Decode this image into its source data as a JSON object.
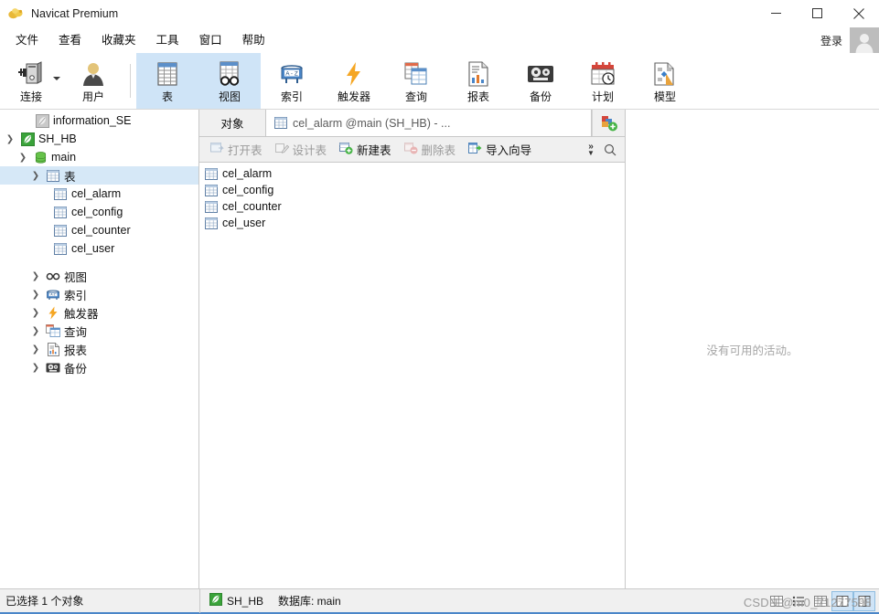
{
  "window": {
    "title": "Navicat Premium",
    "logo_icon": "navicat-logo-icon",
    "minimize_label": "—",
    "maximize_label": "☐",
    "close_label": "✕"
  },
  "menubar": {
    "items": [
      {
        "label": "文件",
        "name": "menu-file"
      },
      {
        "label": "查看",
        "name": "menu-view"
      },
      {
        "label": "收藏夹",
        "name": "menu-favorites"
      },
      {
        "label": "工具",
        "name": "menu-tools"
      },
      {
        "label": "窗口",
        "name": "menu-window"
      },
      {
        "label": "帮助",
        "name": "menu-help"
      }
    ],
    "login_label": "登录",
    "avatar_icon": "user-avatar-icon"
  },
  "toolbar": {
    "items": [
      {
        "label": "连接",
        "icon": "connection-icon",
        "selected": false,
        "has_caret": true
      },
      {
        "label": "用户",
        "icon": "user-icon",
        "selected": false,
        "has_caret": false
      },
      {
        "label": "表",
        "icon": "table-icon",
        "selected": true,
        "has_caret": false
      },
      {
        "label": "视图",
        "icon": "view-glasses-icon",
        "selected": true,
        "has_caret": false
      },
      {
        "label": "索引",
        "icon": "index-az-icon",
        "selected": false,
        "has_caret": false
      },
      {
        "label": "触发器",
        "icon": "trigger-bolt-icon",
        "selected": false,
        "has_caret": false
      },
      {
        "label": "查询",
        "icon": "query-icon",
        "selected": false,
        "has_caret": false
      },
      {
        "label": "报表",
        "icon": "report-icon",
        "selected": false,
        "has_caret": false
      },
      {
        "label": "备份",
        "icon": "backup-tape-icon",
        "selected": false,
        "has_caret": false
      },
      {
        "label": "计划",
        "icon": "schedule-calendar-icon",
        "selected": false,
        "has_caret": false
      },
      {
        "label": "模型",
        "icon": "model-icon",
        "selected": false,
        "has_caret": false
      }
    ]
  },
  "sidebar": {
    "nodes": [
      {
        "label": "information_SE",
        "icon": "connection-leaf-gray-icon",
        "indent": 1,
        "chevron": "none",
        "selected": false
      },
      {
        "label": "SH_HB",
        "icon": "connection-leaf-green-icon",
        "indent": 0,
        "chevron": "down",
        "selected": false
      },
      {
        "label": "main",
        "icon": "database-icon",
        "indent": 1,
        "chevron": "down",
        "selected": false
      },
      {
        "label": "表",
        "icon": "table-icon",
        "indent": 2,
        "chevron": "down",
        "selected": true
      },
      {
        "label": "cel_alarm",
        "icon": "table-icon",
        "indent": 4,
        "chevron": "none",
        "selected": false
      },
      {
        "label": "cel_config",
        "icon": "table-icon",
        "indent": 4,
        "chevron": "none",
        "selected": false
      },
      {
        "label": "cel_counter",
        "icon": "table-icon",
        "indent": 4,
        "chevron": "none",
        "selected": false
      },
      {
        "label": "cel_user",
        "icon": "table-icon",
        "indent": 4,
        "chevron": "none",
        "selected": false
      },
      {
        "label": "视图",
        "icon": "view-glasses-icon",
        "indent": 2,
        "chevron": "right",
        "selected": false
      },
      {
        "label": "索引",
        "icon": "index-az-icon",
        "indent": 2,
        "chevron": "right",
        "selected": false
      },
      {
        "label": "触发器",
        "icon": "trigger-bolt-icon",
        "indent": 2,
        "chevron": "right",
        "selected": false
      },
      {
        "label": "查询",
        "icon": "query-icon",
        "indent": 2,
        "chevron": "right",
        "selected": false
      },
      {
        "label": "报表",
        "icon": "report-icon",
        "indent": 2,
        "chevron": "right",
        "selected": false
      },
      {
        "label": "备份",
        "icon": "backup-tape-icon",
        "indent": 2,
        "chevron": "right",
        "selected": false
      }
    ]
  },
  "center": {
    "objects_tab_label": "对象",
    "active_tab": {
      "text": "cel_alarm @main (SH_HB) - ...",
      "icon": "table-icon"
    },
    "new_tab_icon": "new-tab-plus-icon",
    "actions": [
      {
        "label": "打开表",
        "icon": "open-table-icon",
        "disabled": true
      },
      {
        "label": "设计表",
        "icon": "design-table-icon",
        "disabled": true
      },
      {
        "label": "新建表",
        "icon": "new-table-icon",
        "disabled": false
      },
      {
        "label": "删除表",
        "icon": "delete-table-icon",
        "disabled": true
      },
      {
        "label": "导入向导",
        "icon": "import-wizard-icon",
        "disabled": false
      }
    ],
    "overflow_icon": "chevron-double-right-icon",
    "search_icon": "search-icon",
    "objects": [
      {
        "label": "cel_alarm",
        "icon": "table-icon"
      },
      {
        "label": "cel_config",
        "icon": "table-icon"
      },
      {
        "label": "cel_counter",
        "icon": "table-icon"
      },
      {
        "label": "cel_user",
        "icon": "table-icon"
      }
    ]
  },
  "right_panel": {
    "empty_message": "没有可用的活动。"
  },
  "statusbar": {
    "selection_text": "已选择 1 个对象",
    "connection_label": "SH_HB",
    "connection_icon": "connection-leaf-green-icon",
    "database_label": "数据库: main",
    "view_modes": [
      {
        "name": "grid-view-icon",
        "active": false
      },
      {
        "name": "list-view-icon",
        "active": false
      },
      {
        "name": "detail-view-icon",
        "active": false
      },
      {
        "name": "form-view-icon",
        "active": true
      },
      {
        "name": "split-view-icon",
        "active": true
      }
    ],
    "watermark": "CSDN @m0_71277598"
  },
  "colors": {
    "accent_blue": "#4a86c8",
    "selection_blue": "#d6e8f7",
    "toolbar_selected": "#cfe4f7",
    "panel_gray": "#f0f0f0",
    "border_gray": "#c8c8c8",
    "green_leaf": "#3aa33a",
    "muted_text": "#a6a6a6"
  }
}
